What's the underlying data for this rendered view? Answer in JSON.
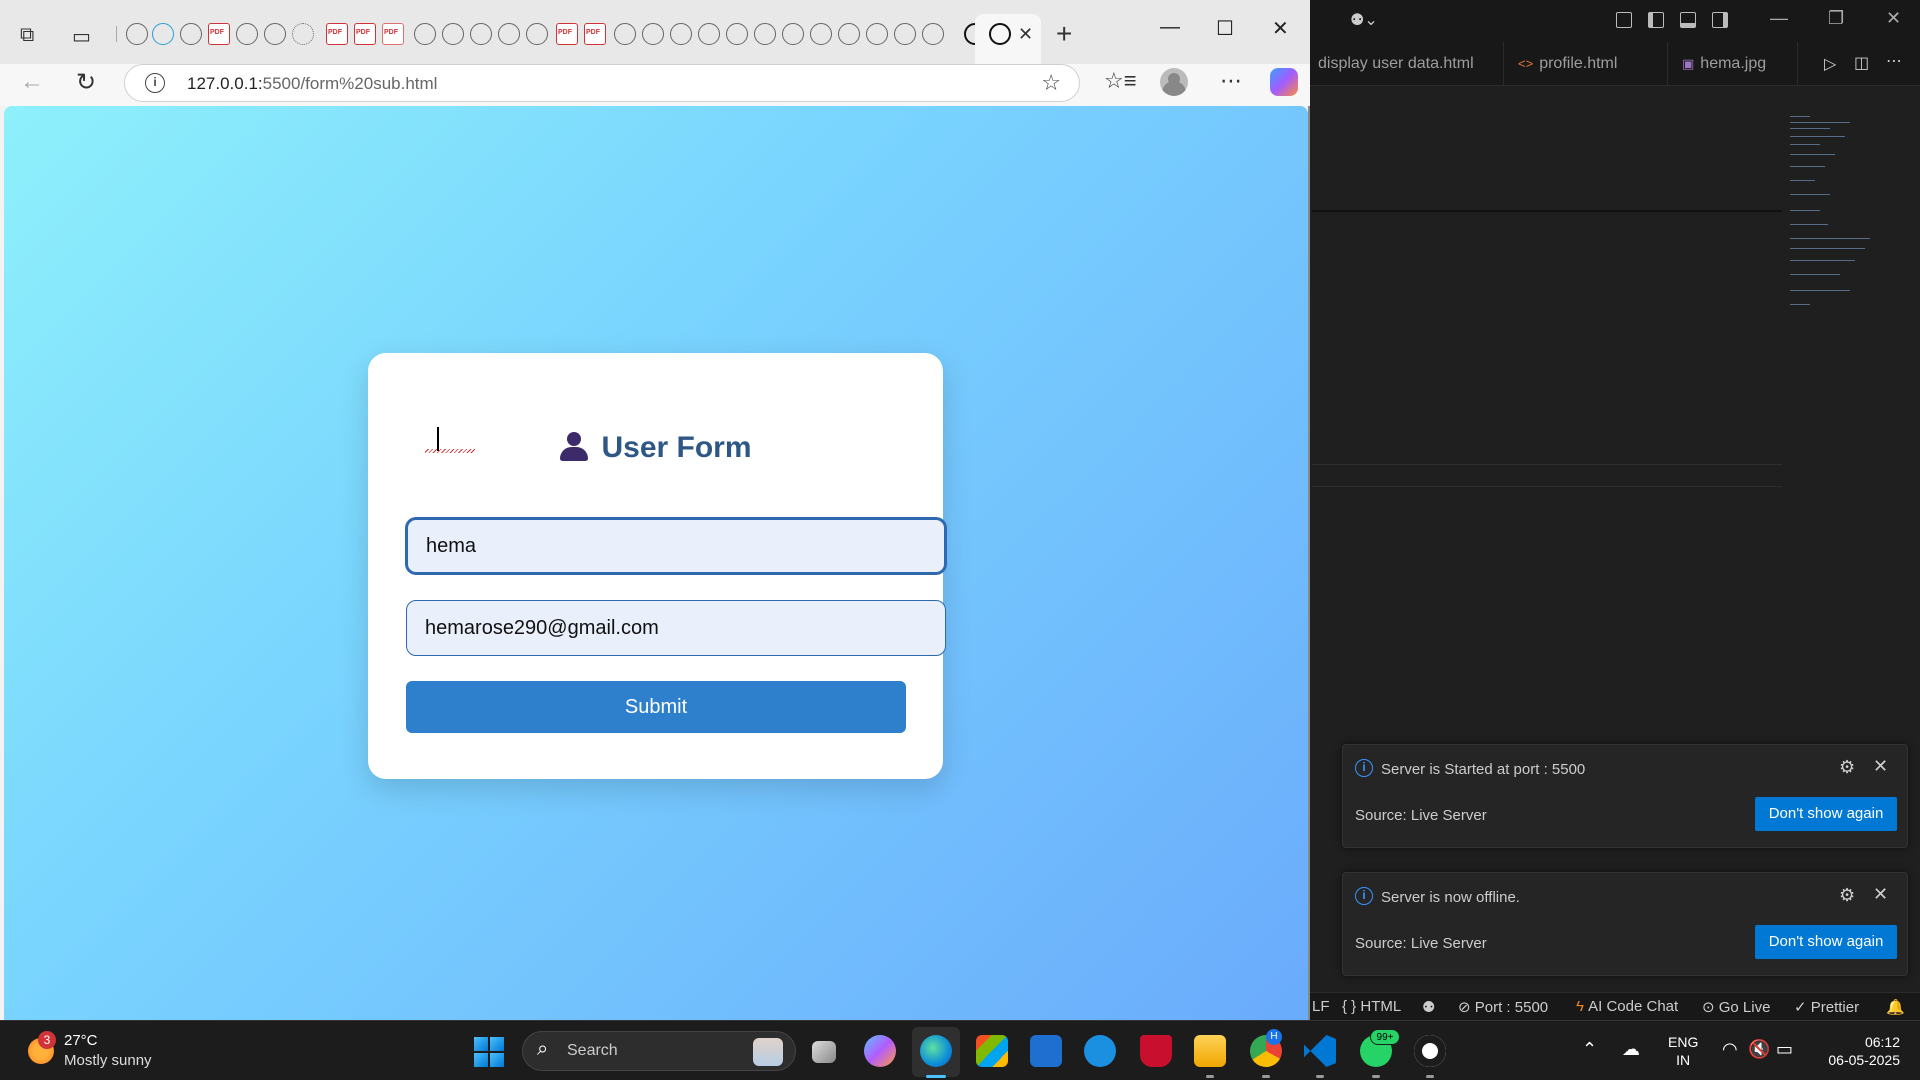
{
  "browser": {
    "url_host": "127.0.0.1:",
    "url_path": "5500/form%20sub.html"
  },
  "page": {
    "title": "User Form",
    "name_value": "hema",
    "email_value": "hemarose290@gmail.com",
    "submit_label": "Submit"
  },
  "vscode": {
    "tabs": [
      "display user data.html",
      "profile.html",
      "hema.jpg"
    ],
    "notifications": [
      {
        "message": "Server is Started at port : 5500",
        "source": "Source: Live Server",
        "button": "Don't show again"
      },
      {
        "message": "Server is now offline.",
        "source": "Source: Live Server",
        "button": "Don't show again"
      }
    ],
    "statusbar": {
      "left": "LF",
      "language": "HTML",
      "port": "Port : 5500",
      "ai": "AI Code Chat",
      "golive": "Go Live",
      "prettier": "Prettier"
    }
  },
  "taskbar": {
    "weather_badge": "3",
    "temperature": "27°C",
    "condition": "Mostly sunny",
    "search_placeholder": "Search",
    "whatsapp_badge": "99+",
    "chrome_badge": "H",
    "lang_line1": "ENG",
    "lang_line2": "IN",
    "time": "06:12",
    "date": "06-05-2025"
  }
}
